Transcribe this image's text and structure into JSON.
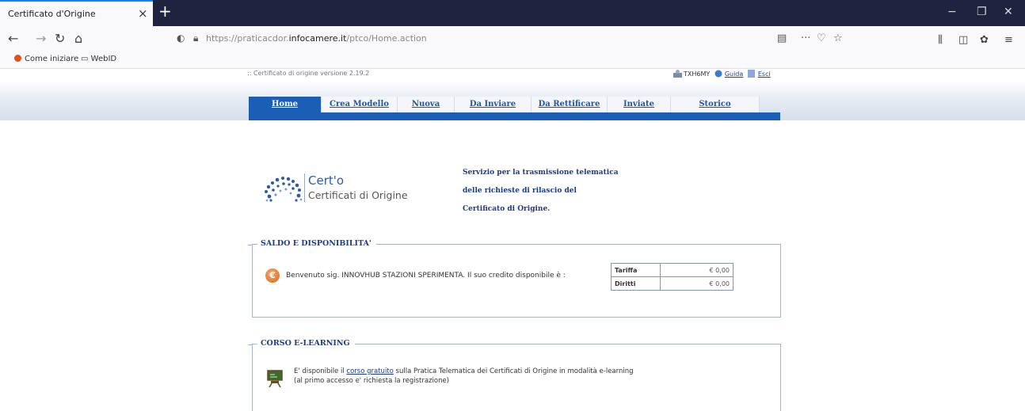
{
  "browser": {
    "tab_title": "Certificato d'Origine",
    "tab_close": "×",
    "new_tab": "+",
    "url_prefix": "https://praticacdor.",
    "url_domain": "infocamere.it",
    "url_path": "/ptco/Home.action",
    "bookmarks": [
      {
        "label": "Come iniziare"
      },
      {
        "label": "WebID"
      }
    ],
    "window_controls": {
      "minimize": "−",
      "restore": "❐",
      "close": "✕"
    }
  },
  "header": {
    "version": ":: Certificato di origine versione 2.19.2",
    "user": "TXH6MY",
    "help": "Guida",
    "exit": "Esci"
  },
  "menu": {
    "items": [
      {
        "label": "Home",
        "active": true
      },
      {
        "label": "Crea Modello",
        "active": false
      },
      {
        "label": "Nuova",
        "active": false
      },
      {
        "label": "Da Inviare",
        "active": false
      },
      {
        "label": "Da Rettificare",
        "active": false
      },
      {
        "label": "Inviate",
        "active": false
      },
      {
        "label": "Storico",
        "active": false
      }
    ]
  },
  "logo": {
    "title": "Cert'o",
    "subtitle": "Certificati di Origine"
  },
  "service": {
    "line1": "Servizio per la trasmissione telematica",
    "line2": "delle richieste di rilascio del",
    "line3": "Certificato di Origine."
  },
  "saldo": {
    "legend": "SALDO E DISPONIBILITA'",
    "euro_symbol": "€",
    "welcome": "Benvenuto sig. INNOVHUB STAZIONI SPERIMENTA. Il suo credito disponibile è :",
    "rows": [
      {
        "label": "Tariffa",
        "value": "€ 0,00"
      },
      {
        "label": "Diritti",
        "value": "€ 0,00"
      }
    ]
  },
  "elearning": {
    "legend": "CORSO E-LEARNING",
    "text_before": "E' disponibile il ",
    "link": "corso gratuito",
    "text_after": " sulla Pratica Telematica dei Certificati di Origine in modalità e-learning",
    "line2": "(al primo accesso e' richiesta la registrazione)"
  }
}
